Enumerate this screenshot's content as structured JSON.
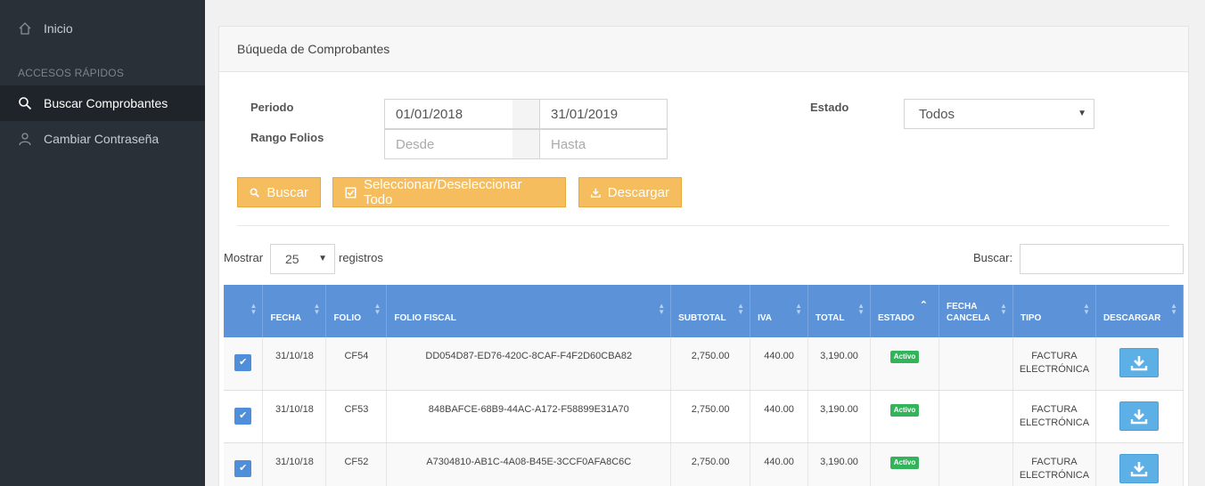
{
  "sidebar": {
    "items": [
      {
        "label": "Inicio",
        "icon": "home-icon"
      },
      {
        "label": "Buscar Comprobantes",
        "icon": "search-icon"
      },
      {
        "label": "Cambiar Contraseña",
        "icon": "user-icon"
      }
    ],
    "section_label": "ACCESOS RÁPIDOS"
  },
  "panel": {
    "title": "Búqueda de Comprobantes"
  },
  "form": {
    "periodo_label": "Periodo",
    "periodo_desde": "01/01/2018",
    "periodo_hasta": "31/01/2019",
    "rango_label": "Rango Folios",
    "rango_desde_placeholder": "Desde",
    "rango_hasta_placeholder": "Hasta",
    "estado_label": "Estado",
    "estado_value": "Todos"
  },
  "buttons": {
    "buscar": "Buscar",
    "seleccionar": "Seleccionar/Deseleccionar Todo",
    "descargar": "Descargar"
  },
  "table_controls": {
    "mostrar_label": "Mostrar",
    "page_size": "25",
    "registros_label": "registros",
    "buscar_label": "Buscar:"
  },
  "table": {
    "headers": [
      "",
      "FECHA",
      "FOLIO",
      "FOLIO FISCAL",
      "SUBTOTAL",
      "IVA",
      "TOTAL",
      "ESTADO",
      "FECHA CANCELA",
      "TIPO",
      "DESCARGAR"
    ],
    "rows": [
      {
        "fecha": "31/10/18",
        "folio": "CF54",
        "folio_fiscal": "DD054D87-ED76-420C-8CAF-F4F2D60CBA82",
        "subtotal": "2,750.00",
        "iva": "440.00",
        "total": "3,190.00",
        "estado": "Activo",
        "fecha_cancela": "",
        "tipo_1": "FACTURA",
        "tipo_2": "ELECTRÓNICA"
      },
      {
        "fecha": "31/10/18",
        "folio": "CF53",
        "folio_fiscal": "848BAFCE-68B9-44AC-A172-F58899E31A70",
        "subtotal": "2,750.00",
        "iva": "440.00",
        "total": "3,190.00",
        "estado": "Activo",
        "fecha_cancela": "",
        "tipo_1": "FACTURA",
        "tipo_2": "ELECTRÓNICA"
      },
      {
        "fecha": "31/10/18",
        "folio": "CF52",
        "folio_fiscal": "A7304810-AB1C-4A08-B45E-3CCF0AFA8C6C",
        "subtotal": "2,750.00",
        "iva": "440.00",
        "total": "3,190.00",
        "estado": "Activo",
        "fecha_cancela": "",
        "tipo_1": "FACTURA",
        "tipo_2": "ELECTRÓNICA"
      }
    ]
  },
  "colors": {
    "sidebar_bg": "#2a3038",
    "header_blue": "#5b92d8",
    "button_orange": "#f5bd5d",
    "active_green": "#33b35a",
    "download_blue": "#5cb0e6"
  }
}
